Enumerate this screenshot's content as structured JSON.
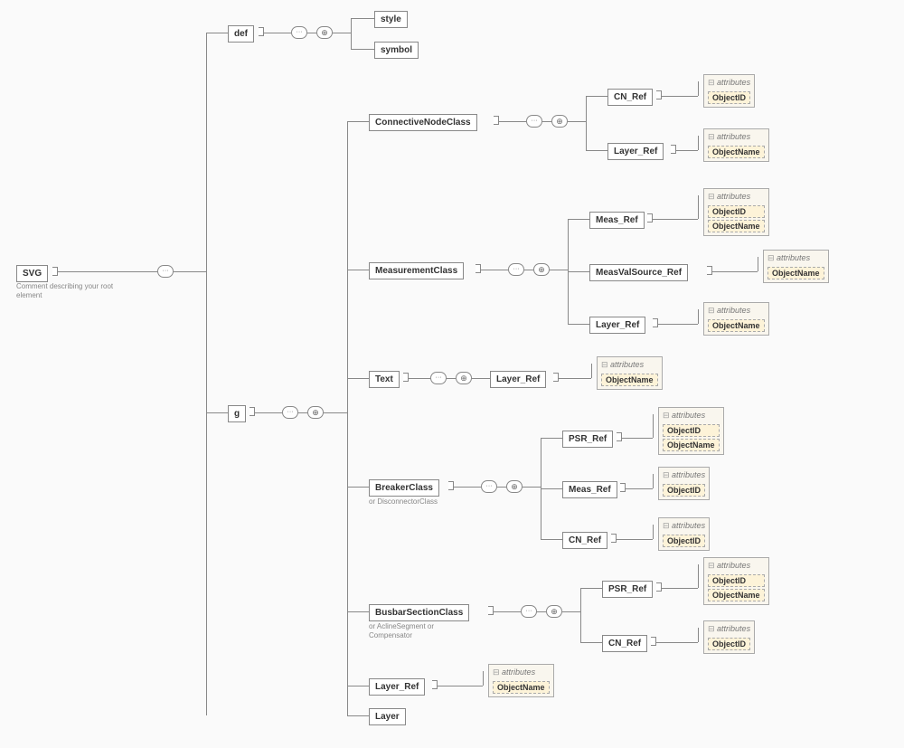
{
  "root": {
    "label": "SVG",
    "comment": "Comment describing your root element"
  },
  "def": {
    "label": "def",
    "children": [
      "style",
      "symbol"
    ]
  },
  "g": {
    "label": "g"
  },
  "cnc": {
    "label": "ConnectiveNodeClass",
    "children": [
      {
        "label": "CN_Ref",
        "attrs": [
          "ObjectID"
        ]
      },
      {
        "label": "Layer_Ref",
        "attrs": [
          "ObjectName"
        ]
      }
    ]
  },
  "mc": {
    "label": "MeasurementClass",
    "children": [
      {
        "label": "Meas_Ref",
        "attrs": [
          "ObjectID",
          "ObjectName"
        ]
      },
      {
        "label": "MeasValSource_Ref",
        "attrs": [
          "ObjectName"
        ]
      },
      {
        "label": "Layer_Ref",
        "attrs": [
          "ObjectName"
        ]
      }
    ]
  },
  "text": {
    "label": "Text",
    "child": {
      "label": "Layer_Ref",
      "attrs": [
        "ObjectName"
      ]
    }
  },
  "bc": {
    "label": "BreakerClass",
    "comment": "or DisconnectorClass",
    "children": [
      {
        "label": "PSR_Ref",
        "attrs": [
          "ObjectID",
          "ObjectName"
        ]
      },
      {
        "label": "Meas_Ref",
        "attrs": [
          "ObjectID"
        ]
      },
      {
        "label": "CN_Ref",
        "attrs": [
          "ObjectID"
        ]
      }
    ]
  },
  "bsc": {
    "label": "BusbarSectionClass",
    "comment": "or AclineSegment or Compensator",
    "children": [
      {
        "label": "PSR_Ref",
        "attrs": [
          "ObjectID",
          "ObjectName"
        ]
      },
      {
        "label": "CN_Ref",
        "attrs": [
          "ObjectID"
        ]
      }
    ]
  },
  "layerref": {
    "label": "Layer_Ref",
    "attrs": [
      "ObjectName"
    ]
  },
  "layer": {
    "label": "Layer"
  },
  "attr_hdr": "attributes"
}
